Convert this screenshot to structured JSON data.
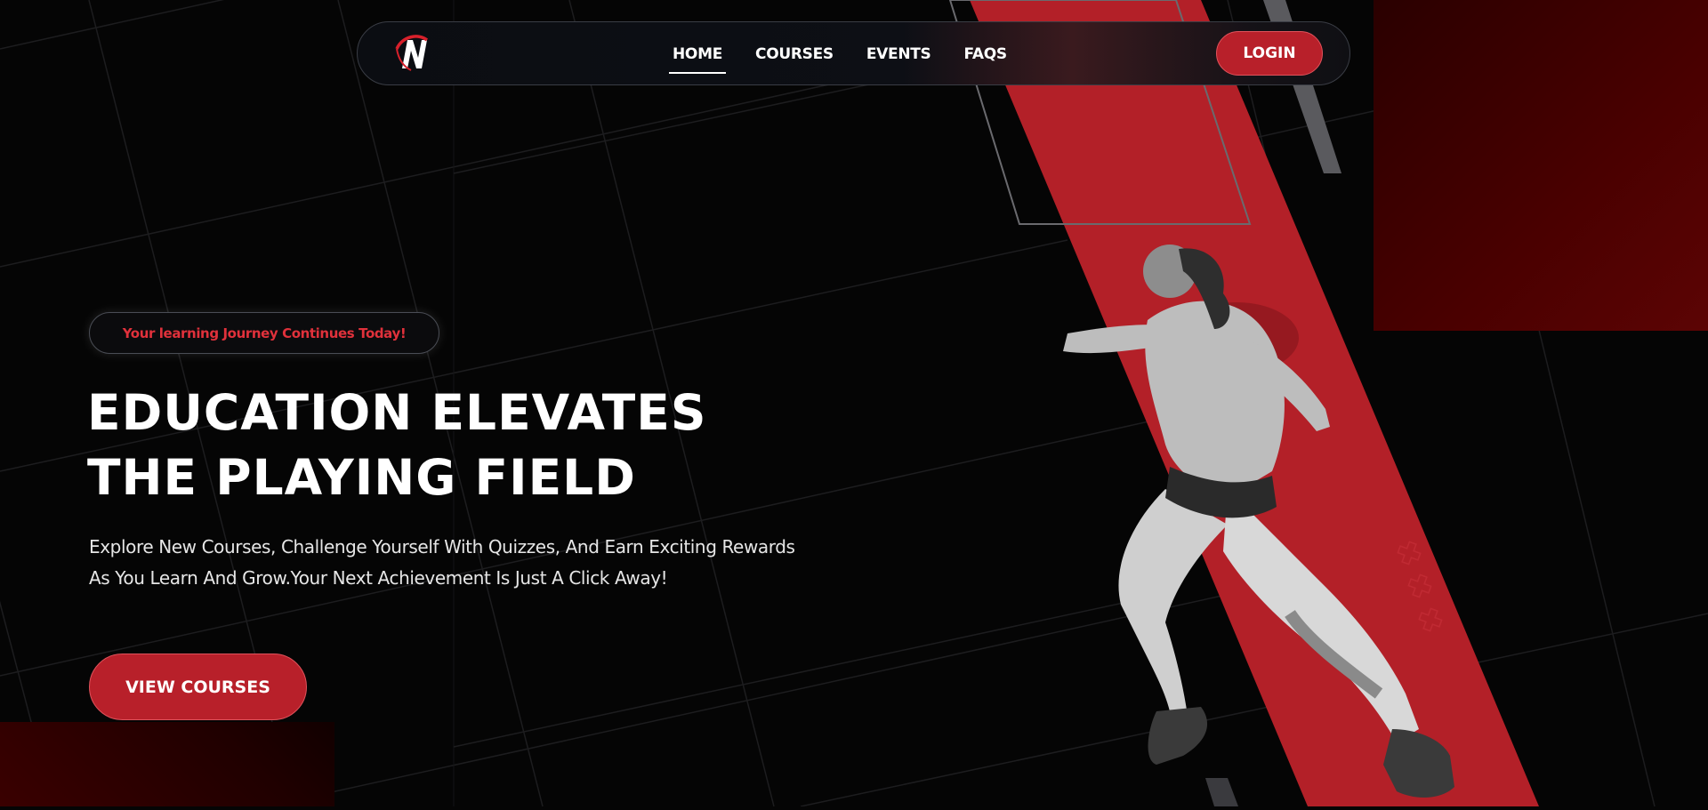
{
  "theme": {
    "accent": "#b8202a",
    "accent_border": "#e0525b",
    "background": "#050505",
    "badge_text": "#e0313b"
  },
  "nav": {
    "logo_icon": "brand-n-logo-icon",
    "links": [
      {
        "label": "HOME",
        "active": true
      },
      {
        "label": "COURSES",
        "active": false
      },
      {
        "label": "EVENTS",
        "active": false
      },
      {
        "label": "FAQS",
        "active": false
      }
    ],
    "login_label": "LOGIN"
  },
  "hero": {
    "badge": "Your learning Journey Continues Today!",
    "title_line1": "EDUCATION ELEVATES",
    "title_line2": "THE PLAYING FIELD",
    "description": "Explore New Courses, Challenge Yourself With Quizzes, And Earn Exciting Rewards As You Learn And Grow.Your Next Achievement Is Just A Click Away!",
    "cta_label": "VIEW COURSES",
    "image": "runner-athlete-photo"
  }
}
